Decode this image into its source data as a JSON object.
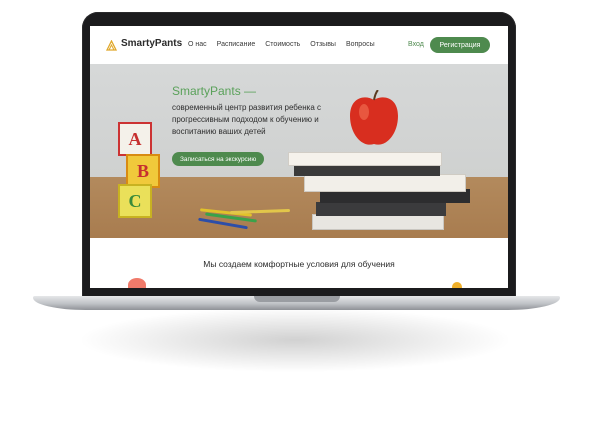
{
  "site": {
    "brand": "SmartyPants",
    "nav": [
      "О нас",
      "Расписание",
      "Стоимость",
      "Отзывы",
      "Вопросы"
    ],
    "login": "Вход",
    "register": "Регистрация"
  },
  "hero": {
    "title": "SmartyPants —",
    "subtitle": "современный центр развития ребенка с прогрессивным подходом к обучению и воспитанию ваших детей",
    "cta": "Записаться на экскурсию"
  },
  "section": {
    "title": "Мы создаем комфортные условия для обучения"
  },
  "colors": {
    "accent": "#4e8a4e",
    "title_green": "#5aa15a"
  },
  "icons": [
    "logo-icon",
    "apple-illustration",
    "abc-blocks",
    "books",
    "pencils"
  ]
}
